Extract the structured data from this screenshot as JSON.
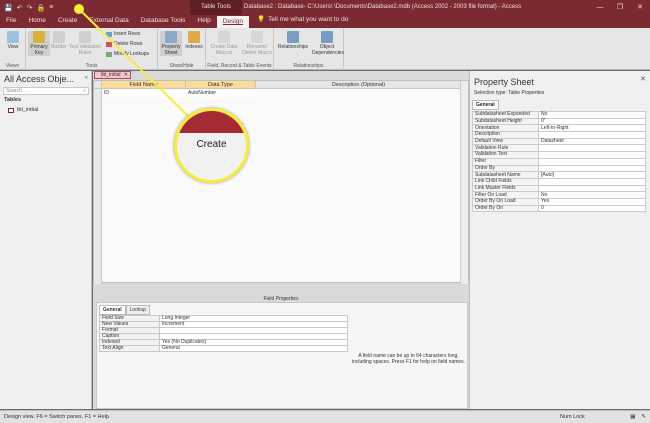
{
  "titlebar": {
    "qat_icons": [
      "save-icon",
      "undo-icon",
      "redo-icon",
      "lock-icon",
      "customize-icon"
    ],
    "context_tab": "Table Tools",
    "window_title": "Database2 : Database- C:\\Users\\       \\Documents\\Database2.mdb (Access 2002 - 2003 file format) - Access",
    "controls": [
      "—",
      "❐",
      "✕"
    ]
  },
  "menu": {
    "tabs": [
      "File",
      "Home",
      "Create",
      "External Data",
      "Database Tools",
      "Help",
      "Design"
    ],
    "active": "Design",
    "tell_me": "Tell me what you want to do"
  },
  "ribbon": {
    "views": {
      "button": "View",
      "group": "Views"
    },
    "tools": {
      "primary_key": "Primary Key",
      "builder": "Builder",
      "test_validation": "Test Validation Rules",
      "insert_rows": "Insert Rows",
      "delete_rows": "Delete Rows",
      "modify_lookups": "Modify Lookups",
      "group": "Tools"
    },
    "showhide": {
      "property_sheet": "Property Sheet",
      "indexes": "Indexes",
      "group": "Show/Hide"
    },
    "events": {
      "create_data_macros": "Create Data Macros",
      "rename_delete_macro": "Rename/ Delete Macro",
      "group": "Field, Record & Table Events"
    },
    "relationships": {
      "relationships": "Relationships",
      "object_dependencies": "Object Dependencies",
      "group": "Relationships"
    }
  },
  "nav": {
    "title": "All Access Obje...",
    "search_placeholder": "Search...",
    "group": "Tables",
    "items": [
      "tbl_initial"
    ]
  },
  "doc": {
    "tab": "tbl_initial",
    "columns": [
      "Field Name",
      "Data Type",
      "Description (Optional)"
    ],
    "rows": [
      {
        "field": "ID",
        "type": "AutoNumber",
        "desc": ""
      }
    ],
    "field_properties_label": "Field Properties",
    "fp_tabs": [
      "General",
      "Lookup"
    ],
    "fp_rows": [
      {
        "k": "Field Size",
        "v": "Long Integer"
      },
      {
        "k": "New Values",
        "v": "Increment"
      },
      {
        "k": "Format",
        "v": ""
      },
      {
        "k": "Caption",
        "v": ""
      },
      {
        "k": "Indexed",
        "v": "Yes (No Duplicates)"
      },
      {
        "k": "Text Align",
        "v": "General"
      }
    ],
    "hint": "A field name can be up to 64 characters long, including spaces. Press F1 for help on field names."
  },
  "property_sheet": {
    "title": "Property Sheet",
    "selection_type": "Selection type:  Table Properties",
    "tab": "General",
    "rows": [
      {
        "k": "Subdatasheet Expanded",
        "v": "No"
      },
      {
        "k": "Subdatasheet Height",
        "v": "0\""
      },
      {
        "k": "Orientation",
        "v": "Left-to-Right"
      },
      {
        "k": "Description",
        "v": ""
      },
      {
        "k": "Default View",
        "v": "Datasheet"
      },
      {
        "k": "Validation Rule",
        "v": ""
      },
      {
        "k": "Validation Text",
        "v": ""
      },
      {
        "k": "Filter",
        "v": ""
      },
      {
        "k": "Order By",
        "v": ""
      },
      {
        "k": "Subdatasheet Name",
        "v": "[Auto]"
      },
      {
        "k": "Link Child Fields",
        "v": ""
      },
      {
        "k": "Link Master Fields",
        "v": ""
      },
      {
        "k": "Filter On Load",
        "v": "No"
      },
      {
        "k": "Order By On Load",
        "v": "Yes"
      },
      {
        "k": "Order By On",
        "v": "0"
      }
    ]
  },
  "status": {
    "left": "Design view.  F6 = Switch panes.  F1 = Help.",
    "numlock": "Num Lock"
  },
  "callout": {
    "label": "Create"
  }
}
